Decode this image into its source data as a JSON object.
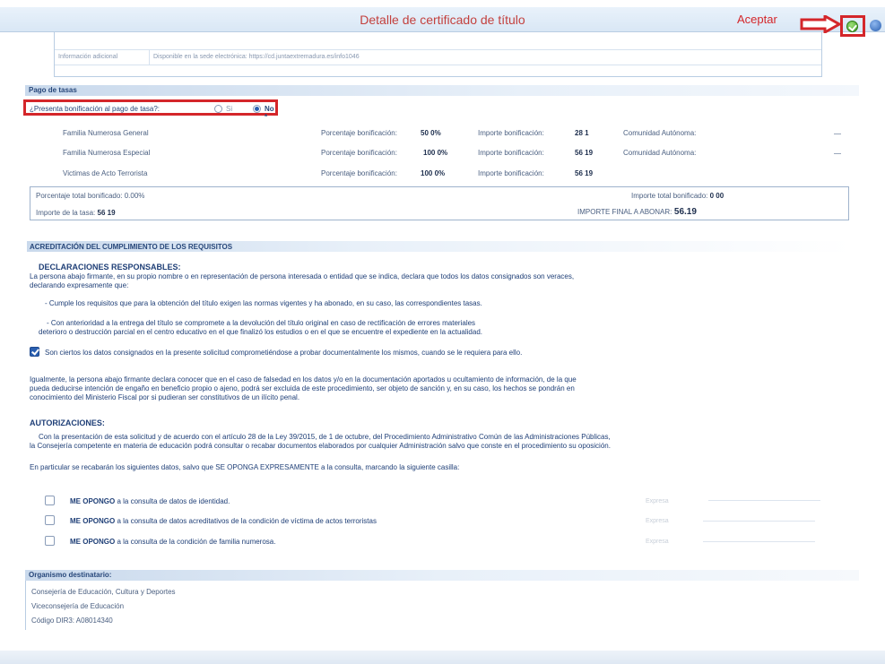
{
  "header": {
    "title": "Detalle de certificado de título",
    "accept_label": "Aceptar",
    "accept_icon": "check-circle-icon",
    "help_icon": "help-circle-icon",
    "annotation_color": "#d4262a"
  },
  "info": {
    "label": "Información adicional",
    "value": "Disponible en la sede electrónica: https://cd.juntaextremadura.es/info1046"
  },
  "pago": {
    "section_title": "Pago de tasas",
    "question": "¿Presenta bonificación al pago de tasa?:",
    "options": {
      "si": "Si",
      "no": "No *",
      "selected": "No *"
    },
    "rows": [
      {
        "name": "Familia Numerosa General",
        "pct_label": "Porcentaje bonificación:",
        "pct": "50 0%",
        "imp_label": "Importe bonificación:",
        "imp": "28 1",
        "ca_label": "Comunidad Autónoma:"
      },
      {
        "name": "Familia Numerosa Especial",
        "pct_label": "Porcentaje bonificación:",
        "pct": "100 0%",
        "imp_label": "Importe bonificación:",
        "imp": "56 19",
        "ca_label": "Comunidad Autónoma:"
      },
      {
        "name": "Victimas de Acto Terrorista",
        "pct_label": "Porcentaje bonificación:",
        "pct": "100 0%",
        "imp_label": "Importe bonificación:",
        "imp": "56 19"
      }
    ],
    "totals": {
      "pct_total": "Porcentaje total bonificado: 0.00%",
      "importe_tasa_label": "Importe de la tasa:",
      "importe_tasa": "56 19",
      "importe_total_label": "Importe total bonificado:",
      "importe_total": "0 00",
      "final_label": "IMPORTE FINAL A ABONAR:",
      "final": "56.19"
    }
  },
  "acreditacion": {
    "section_title": "ACREDITACIÓN DEL CUMPLIMIENTO DE LOS REQUISITOS",
    "declaraciones_title": "DECLARACIONES RESPONSABLES:",
    "intro_1": "La persona abajo firmante, en su propio nombre o en representación de persona interesada o entidad que se indica, declara que todos los datos consignados son veraces,",
    "intro_2": "declarando expresamente que:",
    "item_1": "- Cumple los requisitos que para la obtención del título exigen las normas vigentes y ha abonado, en su caso, las correspondientes tasas.",
    "item_2a": "- Con anterioridad a la entrega del título se compromete a la devolución del título original en caso de rectificación de errores materiales",
    "item_2b": "deterioro o destrucción parcial en el centro educativo en el que finalizó los estudios o en el que se encuentre el expediente en la actualidad.",
    "check_text": "Son ciertos los datos consignados en la presente solicitud comprometiéndose a probar documentalmente los mismos, cuando se le requiera para ello.",
    "igual_1": "Igualmente, la persona abajo firmante declara conocer que en el caso de falsedad en los datos y/o en la documentación aportados u ocultamiento de información, de la que",
    "igual_2": "pueda deducirse intención de engaño en beneficio propio o ajeno, podrá ser excluida de este procedimiento, ser objeto de sanción y, en su caso, los hechos se pondrán en",
    "igual_3": "conocimiento del Ministerio Fiscal por si pudieran ser constitutivos de un ilícito penal."
  },
  "autorizaciones": {
    "title": "AUTORIZACIONES:",
    "p1": "Con la presentación de esta solicitud y de acuerdo con el artículo 28 de la Ley 39/2015, de 1 de octubre, del Procedimiento Administrativo Común de las Administraciones Públicas,",
    "p2": "la Consejería competente en materia de educación podrá consultar o recabar documentos elaborados por cualquier Administración salvo que conste en el procedimiento su oposición.",
    "p3": "En particular se recabarán los siguientes datos, salvo que SE OPONGA EXPRESAMENTE a la consulta, marcando la siguiente casilla:",
    "fecha_label": "Expresa",
    "items": [
      {
        "prefix": "ME OPONGO",
        "text": "a la consulta de datos de identidad."
      },
      {
        "prefix": "ME OPONGO",
        "text": "a la consulta de  datos acreditativos de la condición de víctima de actos terroristas"
      },
      {
        "prefix": "ME OPONGO",
        "text": "a la consulta de la condición de familia numerosa."
      }
    ]
  },
  "organismo": {
    "title": "Organismo destinatario:",
    "line_1": "Consejería de Educación, Cultura y Deportes",
    "line_2": "Viceconsejería de Educación",
    "line_3": "Código DIR3: A08014340"
  }
}
